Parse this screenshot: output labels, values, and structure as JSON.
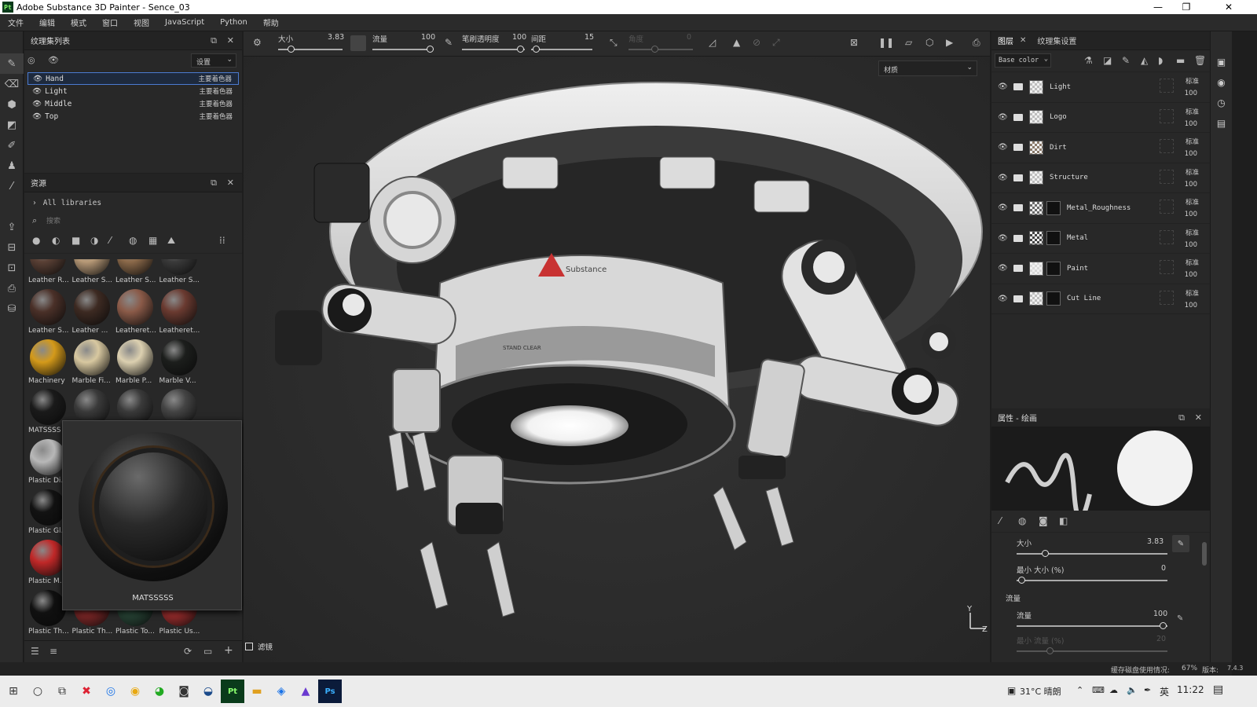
{
  "window": {
    "title": "Adobe Substance 3D Painter - Sence_03",
    "app_badge": "Pt"
  },
  "menu": [
    "文件",
    "编辑",
    "模式",
    "窗口",
    "视图",
    "JavaScript",
    "Python",
    "帮助"
  ],
  "texture_set_list": {
    "title": "纹理集列表",
    "settings_label": "设置",
    "rows": [
      {
        "name": "Hand",
        "shader": "主要着色器",
        "selected": true
      },
      {
        "name": "Light",
        "shader": "主要着色器",
        "selected": false
      },
      {
        "name": "Middle",
        "shader": "主要着色器",
        "selected": false
      },
      {
        "name": "Top",
        "shader": "主要着色器",
        "selected": false
      }
    ]
  },
  "assets": {
    "title": "资源",
    "breadcrumb": "All libraries",
    "search_placeholder": "搜索",
    "materials": [
      {
        "label": "Leather R...",
        "color": "#5a4035"
      },
      {
        "label": "Leather S...",
        "color": "#b89a78"
      },
      {
        "label": "Leather S...",
        "color": "#8c6a4a"
      },
      {
        "label": "Leather S...",
        "color": "#3a3a3a"
      },
      {
        "label": "Leather S...",
        "color": "#4a3028"
      },
      {
        "label": "Leather ...",
        "color": "#3d2a22"
      },
      {
        "label": "Leatheret...",
        "color": "#8a5a48"
      },
      {
        "label": "Leatheret...",
        "color": "#6a3a30"
      },
      {
        "label": "Machinery",
        "color": "#d49a1a"
      },
      {
        "label": "Marble Fi...",
        "color": "#d8c8a0"
      },
      {
        "label": "Marble P...",
        "color": "#dcd0b0"
      },
      {
        "label": "Marble V...",
        "color": "#1c1e1c"
      },
      {
        "label": "MATSSSS",
        "color": "#1a1a1a"
      },
      {
        "label": "",
        "color": "#3a3a3a"
      },
      {
        "label": "",
        "color": "#3a3a3a"
      },
      {
        "label": "",
        "color": "#444"
      },
      {
        "label": "Plastic Di...",
        "color": "#b8b8b8"
      },
      {
        "label": "",
        "color": "#000"
      },
      {
        "label": "",
        "color": "#000"
      },
      {
        "label": "",
        "color": "#000"
      },
      {
        "label": "Plastic Gl...",
        "color": "#121212"
      },
      {
        "label": "",
        "color": "#000"
      },
      {
        "label": "",
        "color": "#000"
      },
      {
        "label": "",
        "color": "#000"
      },
      {
        "label": "Plastic M...",
        "color": "#c02828"
      },
      {
        "label": "",
        "color": "#000"
      },
      {
        "label": "",
        "color": "#000"
      },
      {
        "label": "",
        "color": "#000"
      },
      {
        "label": "Plastic Th...",
        "color": "#101010"
      },
      {
        "label": "Plastic Th...",
        "color": "#8a2a2a"
      },
      {
        "label": "Plastic To...",
        "color": "#2a4a3a"
      },
      {
        "label": "Plastic Us...",
        "color": "#a83030"
      }
    ],
    "preview_label": "MATSSSSS"
  },
  "toolbar": {
    "size_label": "大小",
    "size_value": "3.83",
    "flow_label": "流量",
    "flow_value": "100",
    "stroke_opacity_label": "笔刷透明度",
    "stroke_opacity_value": "100",
    "spacing_label": "间距",
    "spacing_value": "15",
    "angle_label": "角度",
    "angle_value": "0",
    "material_select": "材质"
  },
  "layers": {
    "tab_layers": "图层",
    "tab_ts_settings": "纹理集设置",
    "channel_select": "Base color",
    "blend_mode": "标准",
    "items": [
      {
        "name": "Light",
        "opacity": "100"
      },
      {
        "name": "Logo",
        "opacity": "100"
      },
      {
        "name": "Dirt",
        "opacity": "100"
      },
      {
        "name": "Structure",
        "opacity": "100"
      },
      {
        "name": "Metal_Roughness",
        "opacity": "100"
      },
      {
        "name": "Metal",
        "opacity": "100"
      },
      {
        "name": "Paint",
        "opacity": "100"
      },
      {
        "name": "Cut Line",
        "opacity": "100"
      }
    ]
  },
  "properties": {
    "title": "属性 - 绘画",
    "size_label": "大小",
    "size_value": "3.83",
    "min_size_label": "最小 大小 (%)",
    "min_size_value": "0",
    "flow_section": "流量",
    "flow_label": "流量",
    "flow_value": "100",
    "min_flow_label": "最小 流量 (%)",
    "min_flow_value": "20"
  },
  "viewport": {
    "filter_label": "滤镜",
    "axis_y": "Y",
    "axis_z": "Z",
    "decal_text": "Substance",
    "stand_clear": "STAND CLEAR"
  },
  "status": {
    "cache_label": "缓存磁盘使用情况:",
    "cache_value": "67%",
    "version_label": "版本:",
    "version_value": "7.4.3"
  },
  "taskbar": {
    "weather": "31°C 晴朗",
    "ime": "英",
    "time": "11:22"
  }
}
